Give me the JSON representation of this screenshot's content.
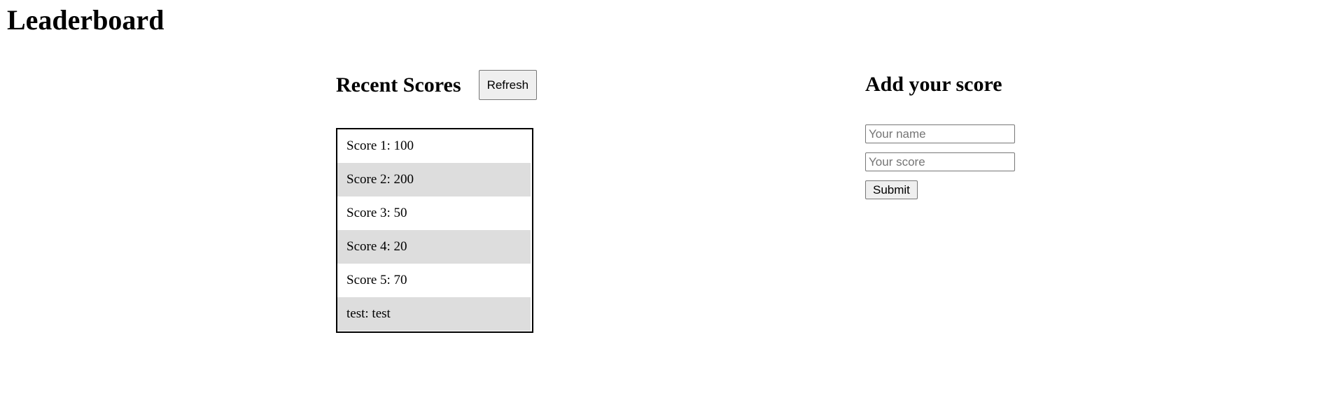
{
  "page": {
    "title": "Leaderboard"
  },
  "recent_scores": {
    "title": "Recent Scores",
    "refresh_label": "Refresh",
    "items": [
      "Score 1: 100",
      "Score 2: 200",
      "Score 3: 50",
      "Score 4: 20",
      "Score 5: 70",
      "test: test"
    ]
  },
  "add_score": {
    "title": "Add your score",
    "name_placeholder": "Your name",
    "name_value": "",
    "score_placeholder": "Your score",
    "score_value": "",
    "submit_label": "Submit"
  },
  "colors": {
    "background": "#ffffff",
    "text": "#000000",
    "row_alt": "#dddddd",
    "list_border": "#000000",
    "button_bg": "#efefef",
    "input_border": "#767676"
  }
}
